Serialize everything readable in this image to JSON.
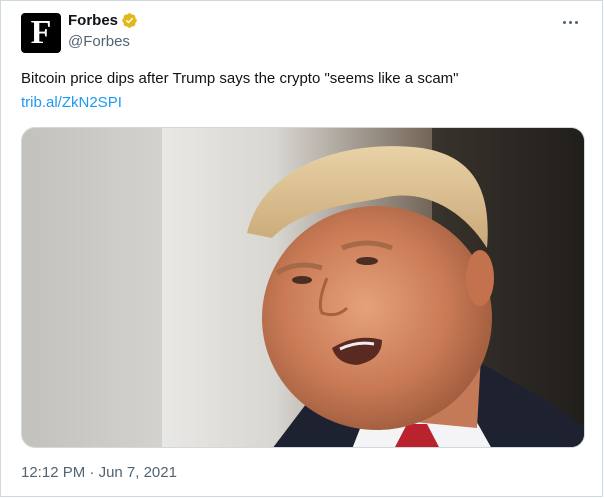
{
  "tweet": {
    "author_name": "Forbes",
    "author_handle": "@Forbes",
    "avatar_letter": "F",
    "text": "Bitcoin price dips after Trump says the crypto \"seems like a scam\"",
    "link_text": "trib.al/ZkN2SPI",
    "time": "12:12 PM",
    "separator": "·",
    "date": "Jun 7, 2021"
  },
  "icons": {
    "verified": "verified-badge-icon",
    "more": "more-options-icon"
  },
  "colors": {
    "link": "#1d9bf0",
    "verified_badge": "#e2b719",
    "secondary_text": "#536471",
    "border": "#cfd9de"
  }
}
